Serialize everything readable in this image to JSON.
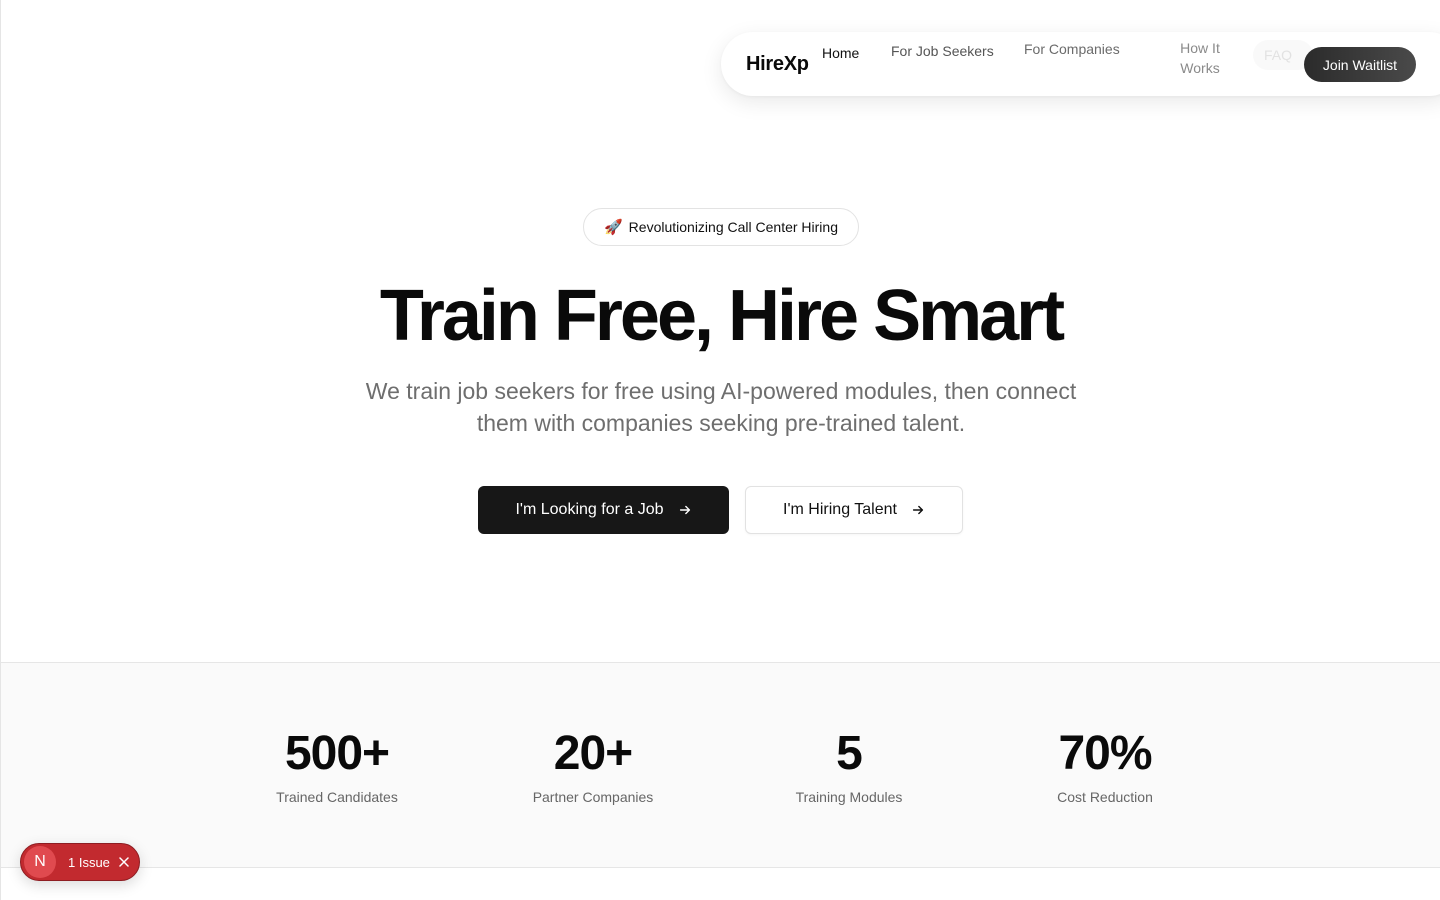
{
  "nav": {
    "brand": "HireXp",
    "links": [
      "Home",
      "For Job Seekers",
      "For Companies",
      "How It Works",
      "FAQ"
    ],
    "cta": "Join Waitlist"
  },
  "hero": {
    "badge_icon": "rocket-icon",
    "badge_text": "Revolutionizing Call Center Hiring",
    "title": "Train Free, Hire Smart",
    "subtitle": "We train job seekers for free using AI-powered modules, then connect them with companies seeking pre-trained talent.",
    "primary_cta": "I'm Looking for a Job",
    "secondary_cta": "I'm Hiring Talent"
  },
  "stats": [
    {
      "value": "500+",
      "label": "Trained Candidates"
    },
    {
      "value": "20+",
      "label": "Partner Companies"
    },
    {
      "value": "5",
      "label": "Training Modules"
    },
    {
      "value": "70%",
      "label": "Cost Reduction"
    }
  ],
  "dev_overlay": {
    "letter": "N",
    "issues": "1 Issue"
  },
  "colors": {
    "primary": "#171717",
    "issue_red": "#c22a2f"
  }
}
